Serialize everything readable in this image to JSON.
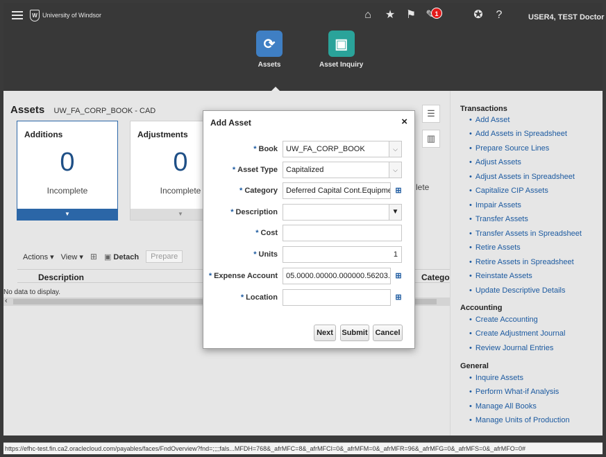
{
  "header": {
    "logo_text": "University of Windsor",
    "logo_mark": "W",
    "user": "USER4, TEST Doctor ▾",
    "notification_count": "1",
    "apps": [
      {
        "label": "Assets",
        "icon": "assets-icon",
        "color": "#3f7fc4"
      },
      {
        "label": "Asset Inquiry",
        "icon": "asset-inquiry-icon",
        "color": "#2aa39a"
      }
    ]
  },
  "page": {
    "title": "Assets",
    "subtitle": "UW_FA_CORP_BOOK - CAD"
  },
  "cards": [
    {
      "title": "Additions",
      "value": "0",
      "label": "Incomplete"
    },
    {
      "title": "Adjustments",
      "value": "0",
      "label": "Incomplete"
    }
  ],
  "card_partial_label": "lete",
  "toolbar": {
    "actions": "Actions ▾",
    "view": "View ▾",
    "detach": "Detach",
    "prepare": "Prepare"
  },
  "table": {
    "columns": [
      "Description",
      "Catego"
    ],
    "empty": "No data to display."
  },
  "sidebar": {
    "sections": [
      {
        "title": "Transactions",
        "links": [
          "Add Asset",
          "Add Assets in Spreadsheet",
          "Prepare Source Lines",
          "Adjust Assets",
          "Adjust Assets in Spreadsheet",
          "Capitalize CIP Assets",
          "Impair Assets",
          "Transfer Assets",
          "Transfer Assets in Spreadsheet",
          "Retire Assets",
          "Retire Assets in Spreadsheet",
          "Reinstate Assets",
          "Update Descriptive Details"
        ]
      },
      {
        "title": "Accounting",
        "links": [
          "Create Accounting",
          "Create Adjustment Journal",
          "Review Journal Entries"
        ]
      },
      {
        "title": "General",
        "links": [
          "Inquire Assets",
          "Perform What-if Analysis",
          "Manage All Books",
          "Manage Units of Production"
        ]
      }
    ]
  },
  "dialog": {
    "title": "Add Asset",
    "close": "×",
    "fields": [
      {
        "label": "Book",
        "value": "UW_FA_CORP_BOOK"
      },
      {
        "label": "Asset Type",
        "value": "Capitalized"
      },
      {
        "label": "Category",
        "value": "Deferred Capital Cont.Equipme"
      },
      {
        "label": "Description",
        "value": ""
      },
      {
        "label": "Cost",
        "value": ""
      },
      {
        "label": "Units",
        "value": "1"
      },
      {
        "label": "Expense Account",
        "value": "05.0000.00000.000000.56203."
      },
      {
        "label": "Location",
        "value": ""
      }
    ],
    "buttons": {
      "next": "Next",
      "submit": "Submit",
      "cancel": "Cancel"
    }
  },
  "statusbar": {
    "url": "https://efhc-test.fin.ca2.oraclecloud.com/payables/faces/FndOverview?fnd=;;;;fals...MFDH=768&_afrMFC=8&_afrMFCI=0&_afrMFM=0&_afrMFR=96&_afrMFG=0&_afrMFS=0&_afrMFO=0#"
  }
}
